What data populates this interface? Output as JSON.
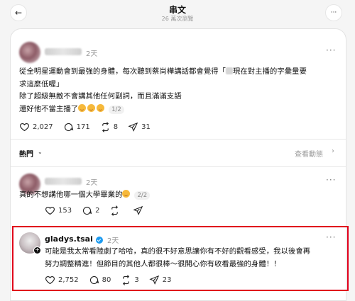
{
  "header": {
    "title": "串文",
    "subtitle": "26 萬次瀏覽",
    "back_label": "←",
    "menu_label": "···"
  },
  "post1": {
    "time": "2天",
    "lines": [
      "從全明星運動會到最強的身體，每次聽到蔡尚樺講話都會覺得「",
      "現在對主播的字彙量要",
      "求這麼低喔」",
      "除了超級無敵不會講其他任何副詞，而且滿滿支語",
      "還好他不當主播了"
    ],
    "pager": "1/2",
    "likes": "2,027",
    "comments": "171",
    "reposts": "8",
    "shares": "31"
  },
  "hot": {
    "label": "熱門",
    "activity": "查看動態"
  },
  "post2": {
    "time": "2天",
    "line": "真的不想講他哪一個大學畢業的",
    "pager": "2/2",
    "likes": "153",
    "comments": "2",
    "reposts": "",
    "shares": ""
  },
  "reply": {
    "username": "gladys.tsai",
    "time": "2天",
    "lines": [
      "可能是我太常看陸劇了哈哈，真的很不好意思讓你有不好的觀看感受，我以後會再",
      "努力調整精進！但節目的其他人都很棒～很開心你有收看最強的身體！！"
    ],
    "likes": "2,752",
    "comments": "80",
    "reposts": "3",
    "shares": "23"
  },
  "colors": {
    "highlight": "#e0001b",
    "verified": "#1d9bf0"
  }
}
